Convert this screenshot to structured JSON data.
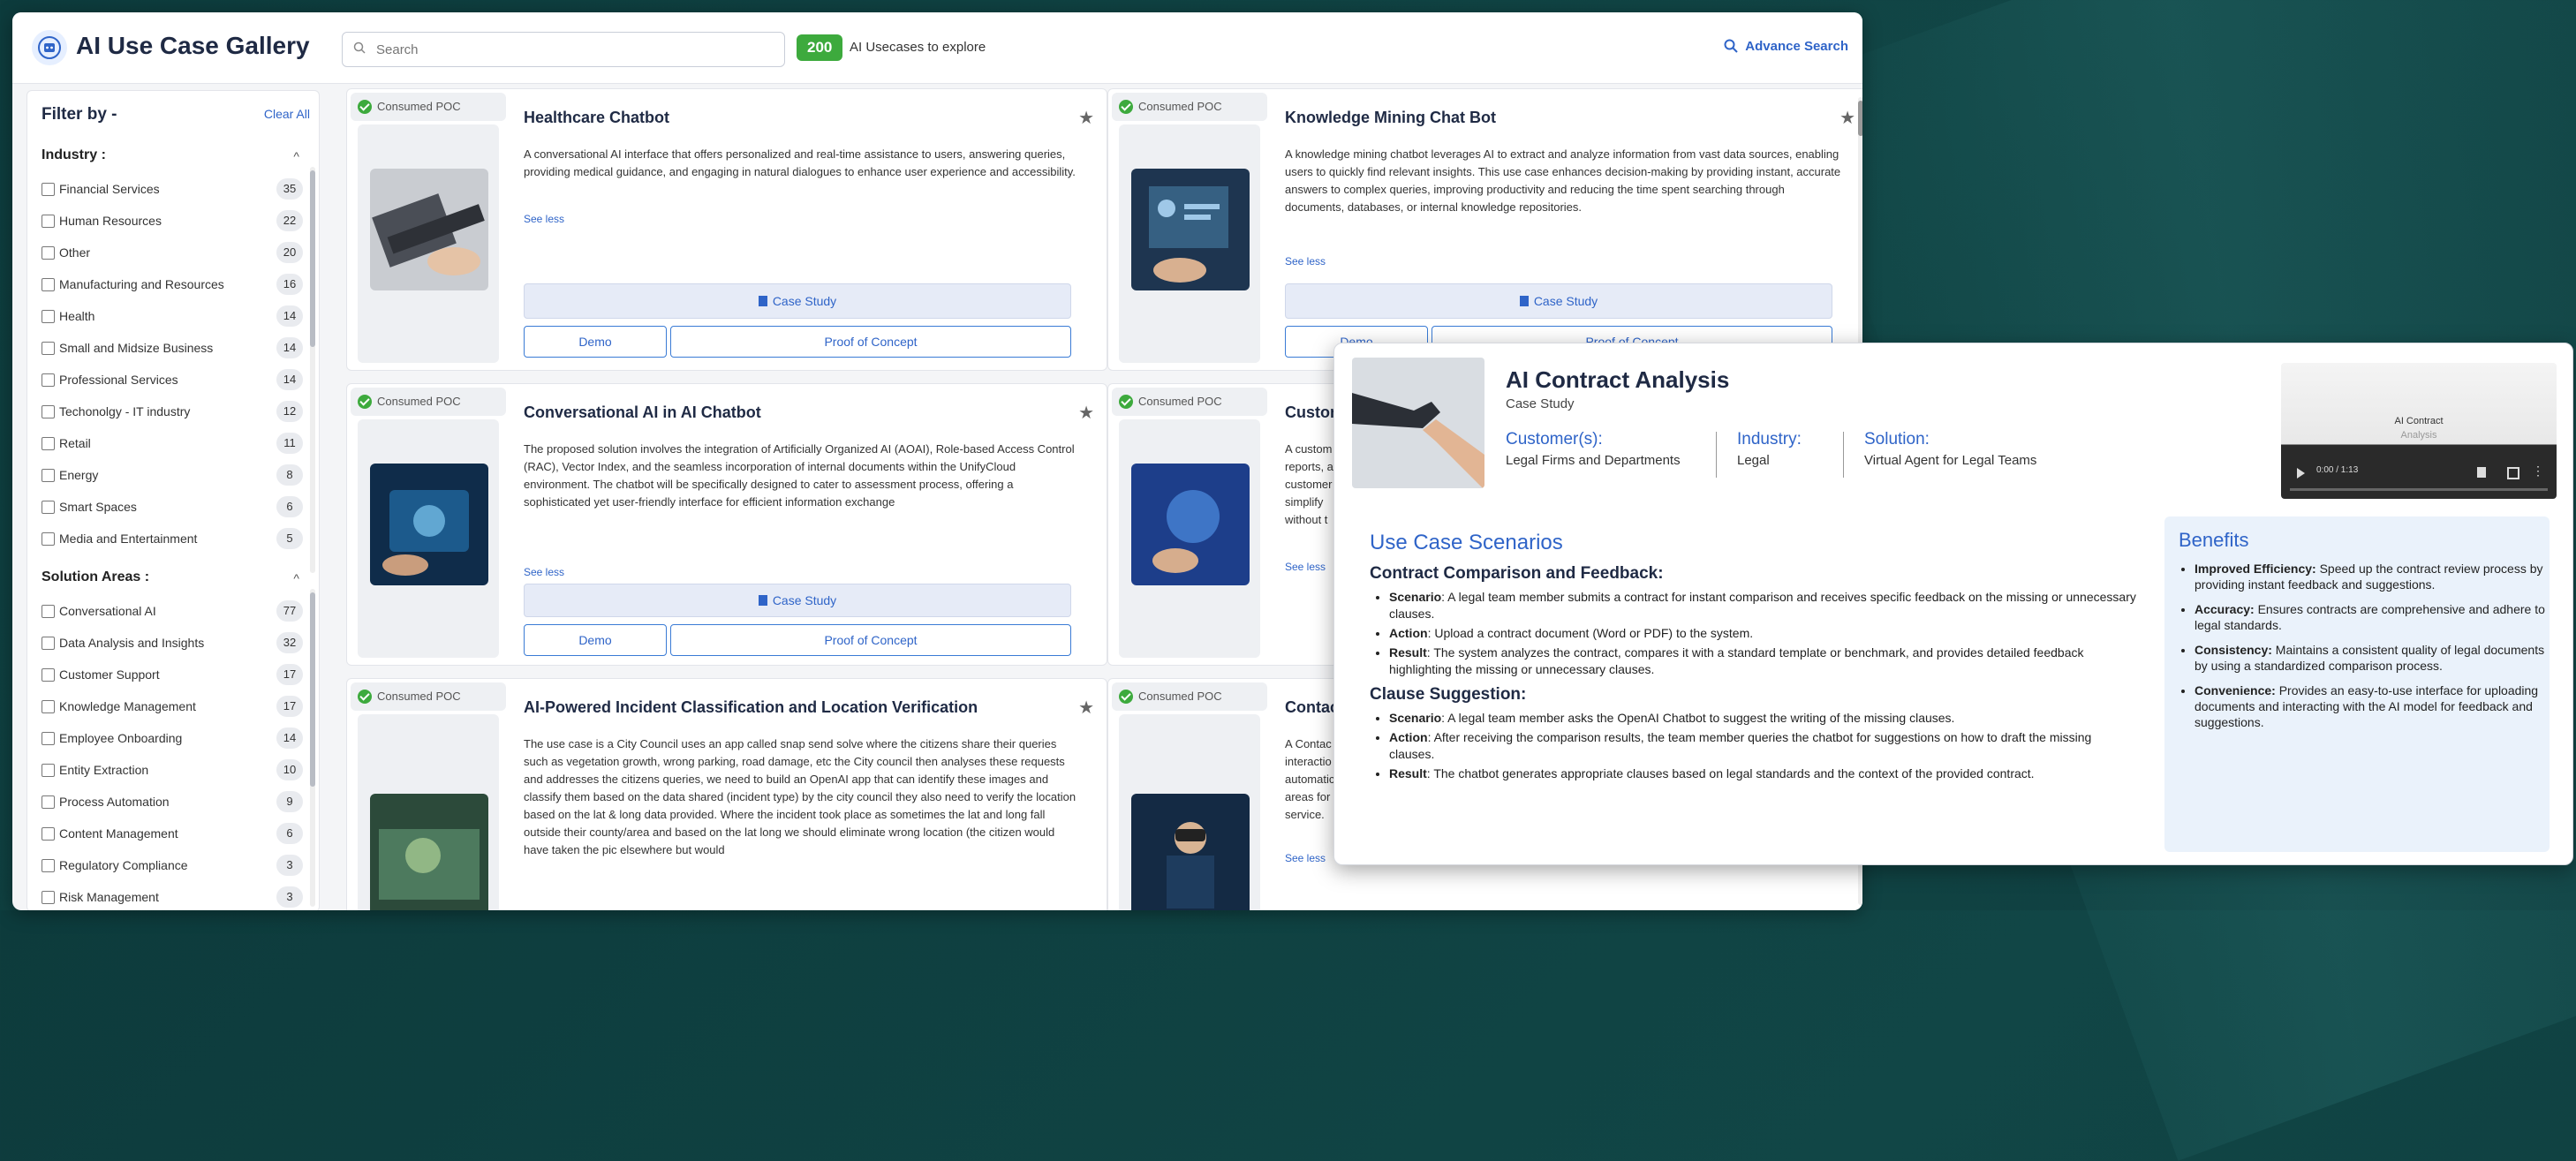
{
  "app": {
    "title": "AI Use Case Gallery",
    "search_placeholder": "Search",
    "count": "200",
    "count_text": "AI Usecases to explore",
    "advance_search": "Advance Search",
    "accent": "#2f64c8",
    "badge_color": "#3daa3d"
  },
  "sidebar": {
    "filter_by": "Filter by -",
    "clear_all": "Clear All",
    "industry": {
      "title": "Industry :",
      "items": [
        {
          "label": "Financial Services",
          "count": "35"
        },
        {
          "label": "Human Resources",
          "count": "22"
        },
        {
          "label": "Other",
          "count": "20"
        },
        {
          "label": "Manufacturing and Resources",
          "count": "16"
        },
        {
          "label": "Health",
          "count": "14"
        },
        {
          "label": "Small and Midsize Business",
          "count": "14"
        },
        {
          "label": "Professional Services",
          "count": "14"
        },
        {
          "label": "Techonolgy - IT industry",
          "count": "12"
        },
        {
          "label": "Retail",
          "count": "11"
        },
        {
          "label": "Energy",
          "count": "8"
        },
        {
          "label": "Smart Spaces",
          "count": "6"
        },
        {
          "label": "Media and Entertainment",
          "count": "5"
        }
      ]
    },
    "solution": {
      "title": "Solution Areas :",
      "items": [
        {
          "label": "Conversational AI",
          "count": "77"
        },
        {
          "label": "Data Analysis and Insights",
          "count": "32"
        },
        {
          "label": "Customer Support",
          "count": "17"
        },
        {
          "label": "Knowledge Management",
          "count": "17"
        },
        {
          "label": "Employee Onboarding",
          "count": "14"
        },
        {
          "label": "Entity Extraction",
          "count": "10"
        },
        {
          "label": "Process Automation",
          "count": "9"
        },
        {
          "label": "Content Management",
          "count": "6"
        },
        {
          "label": "Regulatory Compliance",
          "count": "3"
        },
        {
          "label": "Risk Management",
          "count": "3"
        }
      ]
    }
  },
  "cards": [
    {
      "badge": "Consumed POC",
      "title": "Healthcare Chatbot",
      "desc": "A conversational AI interface that offers personalized and real-time assistance to users, answering queries, providing medical guidance, and engaging in natural dialogues to enhance user experience and accessibility.",
      "see_less": "See less",
      "case_study": "Case Study",
      "demo": "Demo",
      "poc": "Proof of Concept"
    },
    {
      "badge": "Consumed POC",
      "title": "Knowledge Mining Chat Bot",
      "desc": "A knowledge mining chatbot leverages AI to extract and analyze information from vast data sources, enabling users to quickly find relevant insights. This use case enhances decision-making by providing instant, accurate answers to complex queries, improving productivity and reducing the time spent searching through documents, databases, or internal knowledge repositories.",
      "see_less": "See less",
      "case_study": "Case Study",
      "demo": "Demo",
      "poc": "Proof of Concept"
    },
    {
      "badge": "Consumed POC",
      "title": "Conversational AI in AI Chatbot",
      "desc": "The proposed solution involves the integration of Artificially Organized AI (AOAI), Role-based Access Control (RAC), Vector Index, and the seamless incorporation of internal documents within the UnifyCloud environment. The chatbot will be specifically designed to cater to assessment process, offering a sophisticated yet user-friendly interface for efficient information exchange",
      "see_less": "See less",
      "case_study": "Case Study",
      "demo": "Demo",
      "poc": "Proof of Concept"
    },
    {
      "badge": "Consumed POC",
      "title": "Custom",
      "desc": "A custom reports, a customer simplify without t",
      "see_less": "See less"
    },
    {
      "badge": "Consumed POC",
      "title": "AI-Powered Incident Classification and Location Verification",
      "desc": "The use case is a City Council uses an app called snap send solve where the citizens share their queries such as vegetation growth, wrong parking, road damage, etc the City council then analyses these requests and addresses the citizens queries, we need to build an OpenAI app that can identify these images and classify them based on the data shared (incident type) by the city council they also need to verify the location based on the lat & long data provided. Where the incident took place as sometimes the lat and long fall outside their county/area and based on the lat long we should eliminate wrong location (the citizen would have taken the pic elsewhere but would"
    },
    {
      "badge": "Consumed POC",
      "title": "Contac",
      "desc": "A Contac interactio automatic areas for service.",
      "see_less": "See less"
    }
  ],
  "popup": {
    "title": "AI Contract Analysis",
    "subtitle": "Case Study",
    "customer_h": "Customer(s):",
    "customer_v": "Legal Firms and Departments",
    "industry_h": "Industry:",
    "industry_v": "Legal",
    "solution_h": "Solution:",
    "solution_v": "Virtual Agent for Legal Teams",
    "video_title": "AI Contract",
    "video_sub": "Analysis",
    "video_time": "0:00 / 1:13",
    "scenarios_h": "Use Case Scenarios",
    "s1_h": "Contract Comparison and Feedback:",
    "s1_items": [
      {
        "k": "Scenario",
        "v": ": A legal team member submits a contract for instant comparison and receives specific feedback on the missing or unnecessary clauses."
      },
      {
        "k": "Action",
        "v": ": Upload a contract document (Word or PDF) to the system."
      },
      {
        "k": "Result",
        "v": ": The system analyzes the contract, compares it with a standard template or benchmark, and provides detailed feedback highlighting the missing or unnecessary clauses."
      }
    ],
    "s2_h": "Clause Suggestion:",
    "s2_items": [
      {
        "k": "Scenario",
        "v": ": A legal team member asks the OpenAI Chatbot to suggest the writing of the missing clauses."
      },
      {
        "k": "Action",
        "v": ": After receiving the comparison results, the team member queries the chatbot for suggestions on how to draft the missing clauses."
      },
      {
        "k": "Result",
        "v": ": The chatbot generates appropriate clauses based on legal standards and the context of the provided contract."
      }
    ],
    "benefits_h": "Benefits",
    "benefits": [
      {
        "k": "Improved Efficiency:",
        "v": " Speed up the contract review process by providing instant feedback and suggestions."
      },
      {
        "k": "Accuracy:",
        "v": " Ensures contracts are comprehensive and adhere to legal standards."
      },
      {
        "k": "Consistency:",
        "v": " Maintains a consistent quality of legal documents by using a standardized comparison process."
      },
      {
        "k": "Convenience:",
        "v": " Provides an easy-to-use interface for uploading documents and interacting with the AI model for feedback and suggestions."
      }
    ]
  }
}
